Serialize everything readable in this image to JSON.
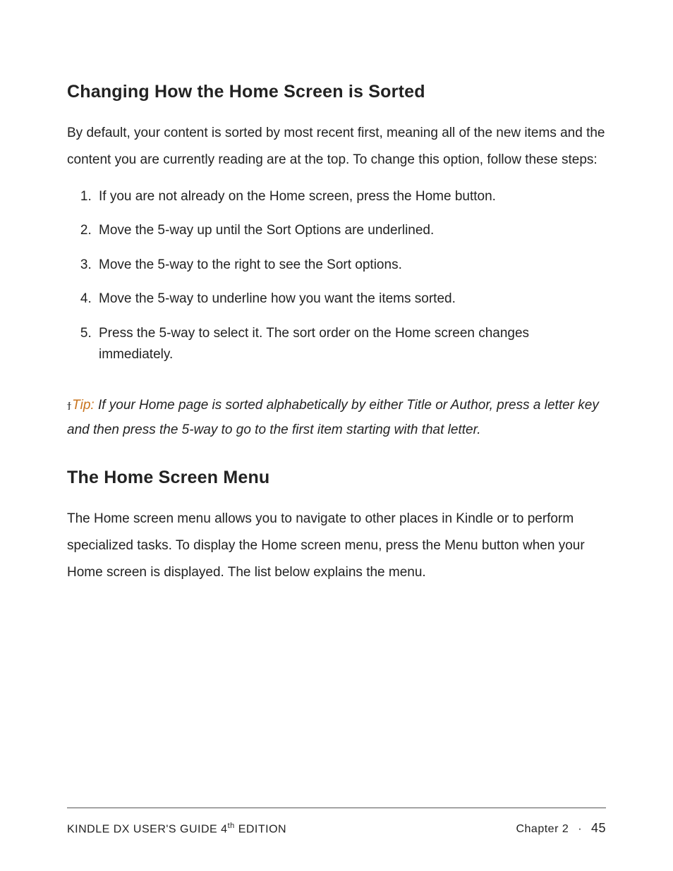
{
  "section1": {
    "heading": "Changing How the Home Screen is Sorted",
    "intro": "By default, your content is sorted by most recent first, meaning all of the new items and the content you are currently reading are at the top. To change this option, follow these steps:",
    "steps": [
      "If you are not already on the Home screen, press the Home button.",
      "Move the 5-way up until the Sort Options are underlined.",
      "Move the 5-way to the right to see the Sort options.",
      "Move the 5-way to underline how you want the items sorted.",
      "Press the 5-way to select it. The sort order on the Home screen changes immediately."
    ]
  },
  "tip": {
    "icon": "ϯ",
    "label": "Tip:",
    "text": " If your Home page is sorted alphabetically by either Title or Author, press a letter key and then press the 5-way to go to the first item starting with that letter."
  },
  "section2": {
    "heading": "The Home Screen Menu",
    "intro": "The Home screen menu allows you to navigate to other places in Kindle or to perform specialized tasks. To display the Home screen menu, press the Menu button when your Home screen is displayed. The list below explains the menu."
  },
  "footer": {
    "left_pre": "KINDLE DX USER'S GUIDE 4",
    "left_sup": "th",
    "left_post": " EDITION",
    "chapter": "Chapter 2",
    "dot": "·",
    "page": "45"
  }
}
